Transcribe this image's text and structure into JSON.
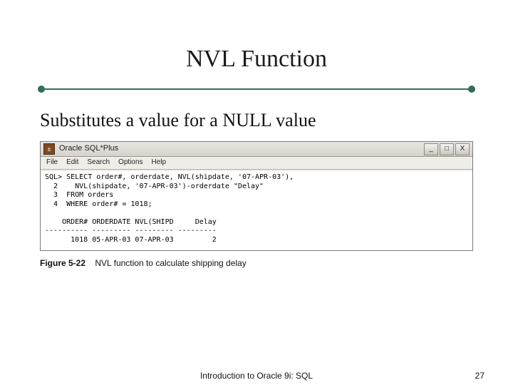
{
  "slide": {
    "title": "NVL Function",
    "subtitle": "Substitutes a value for a NULL value",
    "footer_text": "Introduction to Oracle 9i: SQL",
    "page_number": "27"
  },
  "window": {
    "app_title": "Oracle SQL*Plus",
    "icon_glyph": "±",
    "buttons": {
      "min": "_",
      "max": "□",
      "close": "X"
    },
    "menu": [
      "File",
      "Edit",
      "Search",
      "Options",
      "Help"
    ]
  },
  "terminal": {
    "lines": [
      "SQL> SELECT order#, orderdate, NVL(shipdate, '07-APR-03'),",
      "  2    NVL(shipdate, '07-APR-03')-orderdate \"Delay\"",
      "  3  FROM orders",
      "  4  WHERE order# = 1018;",
      "",
      "    ORDER# ORDERDATE NVL(SHIPD     Delay",
      "---------- --------- --------- ---------",
      "      1018 05-APR-03 07-APR-03         2"
    ]
  },
  "caption": {
    "label": "Figure 5-22",
    "text": "NVL function to calculate shipping delay"
  },
  "colors": {
    "accent": "#2f6f58"
  }
}
